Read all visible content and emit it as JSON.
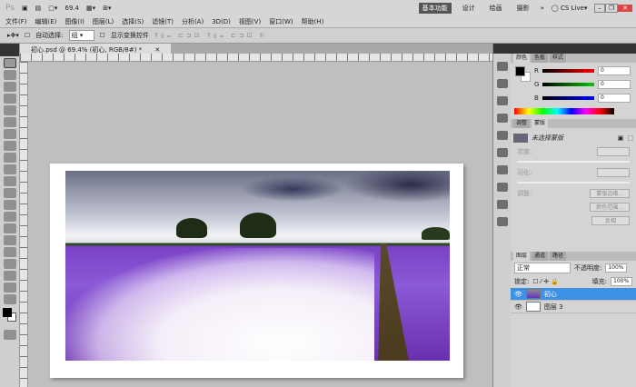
{
  "app": {
    "logo": "Ps",
    "zoom": "69.4",
    "workspaces": [
      "基本功能",
      "设计",
      "绘画",
      "摄影"
    ],
    "more": "»",
    "cslive": "CS Live"
  },
  "menu": [
    "文件(F)",
    "编辑(E)",
    "图像(I)",
    "图层(L)",
    "选择(S)",
    "滤镜(T)",
    "分析(A)",
    "3D(D)",
    "视图(V)",
    "窗口(W)",
    "帮助(H)"
  ],
  "options": {
    "auto_select_label": "自动选择:",
    "auto_select_value": "组",
    "show_transform": "显示变换控件"
  },
  "document": {
    "tab": "初心.psd @ 69.4% (初心, RGB/8#) *"
  },
  "color_panel": {
    "tabs": [
      "颜色",
      "色板",
      "样式"
    ],
    "channels": [
      {
        "label": "R",
        "value": "0"
      },
      {
        "label": "G",
        "value": "0"
      },
      {
        "label": "B",
        "value": "0"
      }
    ],
    "foreground": "#000000",
    "background": "#ffffff"
  },
  "masks_panel": {
    "tabs": [
      "调整",
      "蒙版"
    ],
    "title": "未选择蒙版",
    "density": "浓度:",
    "feather": "羽化:",
    "refine": "调整:",
    "buttons": [
      "蒙版边缘...",
      "颜色范围...",
      "反相"
    ]
  },
  "layers_panel": {
    "tabs": [
      "图层",
      "通道",
      "路径"
    ],
    "blend": "正常",
    "opacity_label": "不透明度:",
    "opacity": "100%",
    "lock_label": "锁定:",
    "fill_label": "填充:",
    "fill": "100%",
    "layers": [
      {
        "name": "初心",
        "selected": true
      },
      {
        "name": "图层 3",
        "selected": false
      }
    ]
  }
}
